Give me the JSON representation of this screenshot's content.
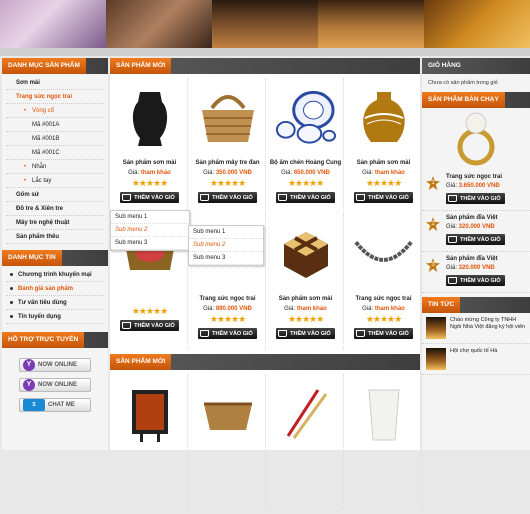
{
  "left": {
    "category_title": "DANH MỤC SẢN PHẨM",
    "categories": [
      {
        "label": "Sơn mài",
        "level": 0
      },
      {
        "label": "Trang sức ngọc trai",
        "level": 0,
        "active": true
      },
      {
        "label": "Vòng cổ",
        "level": 1,
        "active": true
      },
      {
        "label": "Mã #001A",
        "level": 2
      },
      {
        "label": "Mã #001B",
        "level": 2
      },
      {
        "label": "Mã #001C",
        "level": 2
      },
      {
        "label": "Nhẫn",
        "level": 1
      },
      {
        "label": "Lắc tay",
        "level": 1
      },
      {
        "label": "Gốm sứ",
        "level": 0
      },
      {
        "label": "Đồ tre & Xiên tre",
        "level": 0
      },
      {
        "label": "Mây tre nghệ thuật",
        "level": 0
      },
      {
        "label": "Sản phẩm thêu",
        "level": 0
      }
    ],
    "news_title": "DANH MỤC TIN",
    "news": [
      {
        "label": "Chương trình khuyến mại"
      },
      {
        "label": "Đánh giá sản phẩm",
        "active": true
      },
      {
        "label": "Tư vấn tiêu dùng"
      },
      {
        "label": "Tin tuyển dụng"
      }
    ],
    "support_title": "HỖ TRỢ TRỰC TUYẾN",
    "support": [
      {
        "label": "NOW ONLINE",
        "icon": "yahoo-icon"
      },
      {
        "label": "NOW ONLINE",
        "icon": "yahoo-icon"
      },
      {
        "label": "CHAT ME",
        "icon": "skype-icon"
      }
    ]
  },
  "menu": {
    "level1": [
      "Sub menu 1",
      "Sub menu 2",
      "Sub menu 3"
    ],
    "level2": [
      "Sub menu 1",
      "Sub menu 2",
      "Sub menu 3"
    ]
  },
  "main": {
    "new_title": "SẢN PHẨM MỚI",
    "price_label": "Giá:",
    "buy_label": "THÊM VÀO GIỎ",
    "products": [
      {
        "name": "Sản phẩm sơn mài",
        "price": "tham khảo",
        "stars": 5
      },
      {
        "name": "Sản phẩm mây tre đan",
        "price": "350.000 VNĐ",
        "stars": 5
      },
      {
        "name": "Bộ ấm chén Hoàng Cung",
        "price": "650.000 VNĐ",
        "stars": 5
      },
      {
        "name": "Sản phẩm sơn mài",
        "price": "tham khảo",
        "stars": 5
      },
      {
        "name": "",
        "price": "",
        "stars": 5
      },
      {
        "name": "Trang sức ngọc trai",
        "price": "890.000 VNĐ",
        "stars": 5
      },
      {
        "name": "Sản phẩm sơn mài",
        "price": "tham khảo",
        "stars": 5
      },
      {
        "name": "Trang sức ngọc trai",
        "price": "tham khảo",
        "stars": 5
      }
    ],
    "new_title_2": "SẢN PHẨM MỚI"
  },
  "right": {
    "cart_title": "GIỎ HÀNG",
    "cart_empty": "Chưa có sản phẩm trong giỏ",
    "best_title": "SẢN PHẨM BÁN CHẠY",
    "best": [
      {
        "rank": "1",
        "name": "Trang sức ngọc trai",
        "price": "3.650.000 VNĐ"
      },
      {
        "rank": "2",
        "name": "Sản phẩm đĩa Việt",
        "price": "320.000 VNĐ"
      },
      {
        "rank": "3",
        "name": "Sản phẩm đĩa Việt",
        "price": "320.000 VNĐ"
      }
    ],
    "price_label": "Giá:",
    "buy_label": "THÊM VÀO GIỎ",
    "news_title": "TIN TỨC",
    "news": [
      "Chào mừng Công ty TNHH Ngôi Nhà Việt đăng ký hội viên",
      "Hội chợ quốc tế Hà"
    ]
  }
}
